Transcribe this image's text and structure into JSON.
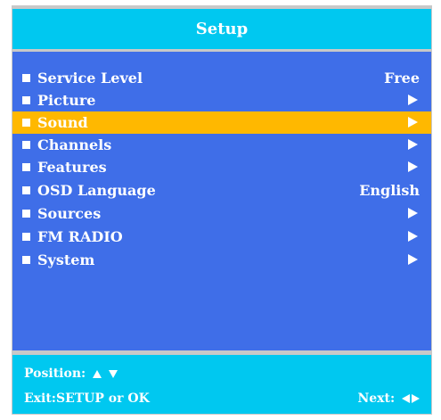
{
  "title": "Setup",
  "colors": {
    "header": "#00c8f0",
    "menu": "#3f6ee8",
    "highlight": "#ffb800",
    "frame": "#c8c8c8",
    "text": "#ffffff"
  },
  "menu": {
    "selected_index": 2,
    "items": [
      {
        "label": "Service Level",
        "value": "Free",
        "icon": ""
      },
      {
        "label": "Picture",
        "value": "",
        "icon": "submenu-arrow-icon"
      },
      {
        "label": "Sound",
        "value": "",
        "icon": "submenu-arrow-icon"
      },
      {
        "label": "Channels",
        "value": "",
        "icon": "submenu-arrow-icon"
      },
      {
        "label": "Features",
        "value": "",
        "icon": "submenu-arrow-icon"
      },
      {
        "label": "OSD Language",
        "value": "English",
        "icon": ""
      },
      {
        "label": "Sources",
        "value": "",
        "icon": "submenu-arrow-icon"
      },
      {
        "label": "FM RADIO",
        "value": "",
        "icon": "submenu-arrow-icon"
      },
      {
        "label": "System",
        "value": "",
        "icon": "submenu-arrow-icon"
      }
    ]
  },
  "footer": {
    "position_label": "Position:",
    "exit_label": "Exit:",
    "exit_keys": "SETUP or OK",
    "next_label": "Next:"
  }
}
